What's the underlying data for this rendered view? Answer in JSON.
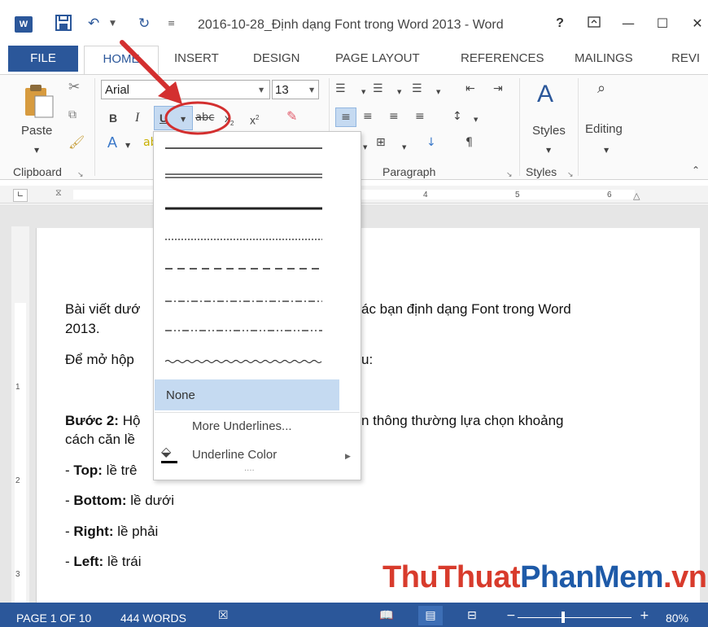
{
  "window": {
    "title": "2016-10-28_Định dạng Font trong Word 2013 - Word",
    "help": "?",
    "app_logo": "W"
  },
  "tabs": [
    "FILE",
    "HOME",
    "INSERT",
    "DESIGN",
    "PAGE LAYOUT",
    "REFERENCES",
    "MAILINGS",
    "REVI"
  ],
  "ribbon": {
    "font_name": "Arial",
    "font_size": "13",
    "paste_label": "Paste",
    "styles_label": "Styles",
    "editing_label": "Editing",
    "groups": {
      "clipboard": "Clipboard",
      "paragraph": "Paragraph",
      "styles": "Styles"
    },
    "bold": "B",
    "italic": "I",
    "underline": "U",
    "strike": "abc",
    "subscript": "x",
    "superscript": "x"
  },
  "ruler": {
    "numbers": [
      "4",
      "5",
      "6"
    ]
  },
  "vruler": {
    "numbers": [
      "1",
      "2",
      "3"
    ]
  },
  "document": {
    "line1a": "Bài viết dướ",
    "line1b": "ác bạn định dạng Font trong Word",
    "line1c": "2013.",
    "line2a": "Để mở hộp",
    "line2b": "u:",
    "step2_bold": "Bước 2:",
    "step2a": " Hộ",
    "step2b": "n thông thường lựa chọn khoảng",
    "step2c": "cách căn lề",
    "top_bold": "Top:",
    "top_text": " lề trê",
    "bottom_bold": "Bottom:",
    "bottom_text": " lề dưới",
    "right_bold": "Right:",
    "right_text": " lề phải",
    "left_bold": "Left:",
    "left_text": " lề trái",
    "dash": "- "
  },
  "underline_menu": {
    "none": "None",
    "more": "More Underlines...",
    "color": "Underline Color"
  },
  "status": {
    "page": "PAGE 1 OF 10",
    "words": "444 WORDS",
    "zoom": "80%"
  },
  "watermark": {
    "part1": "ThuThuat",
    "part2": "PhanMem",
    "part3": ".vn"
  },
  "colors": {
    "accent": "#2b579a",
    "highlight": "#c5daf1",
    "annotation": "#d32f2f"
  }
}
